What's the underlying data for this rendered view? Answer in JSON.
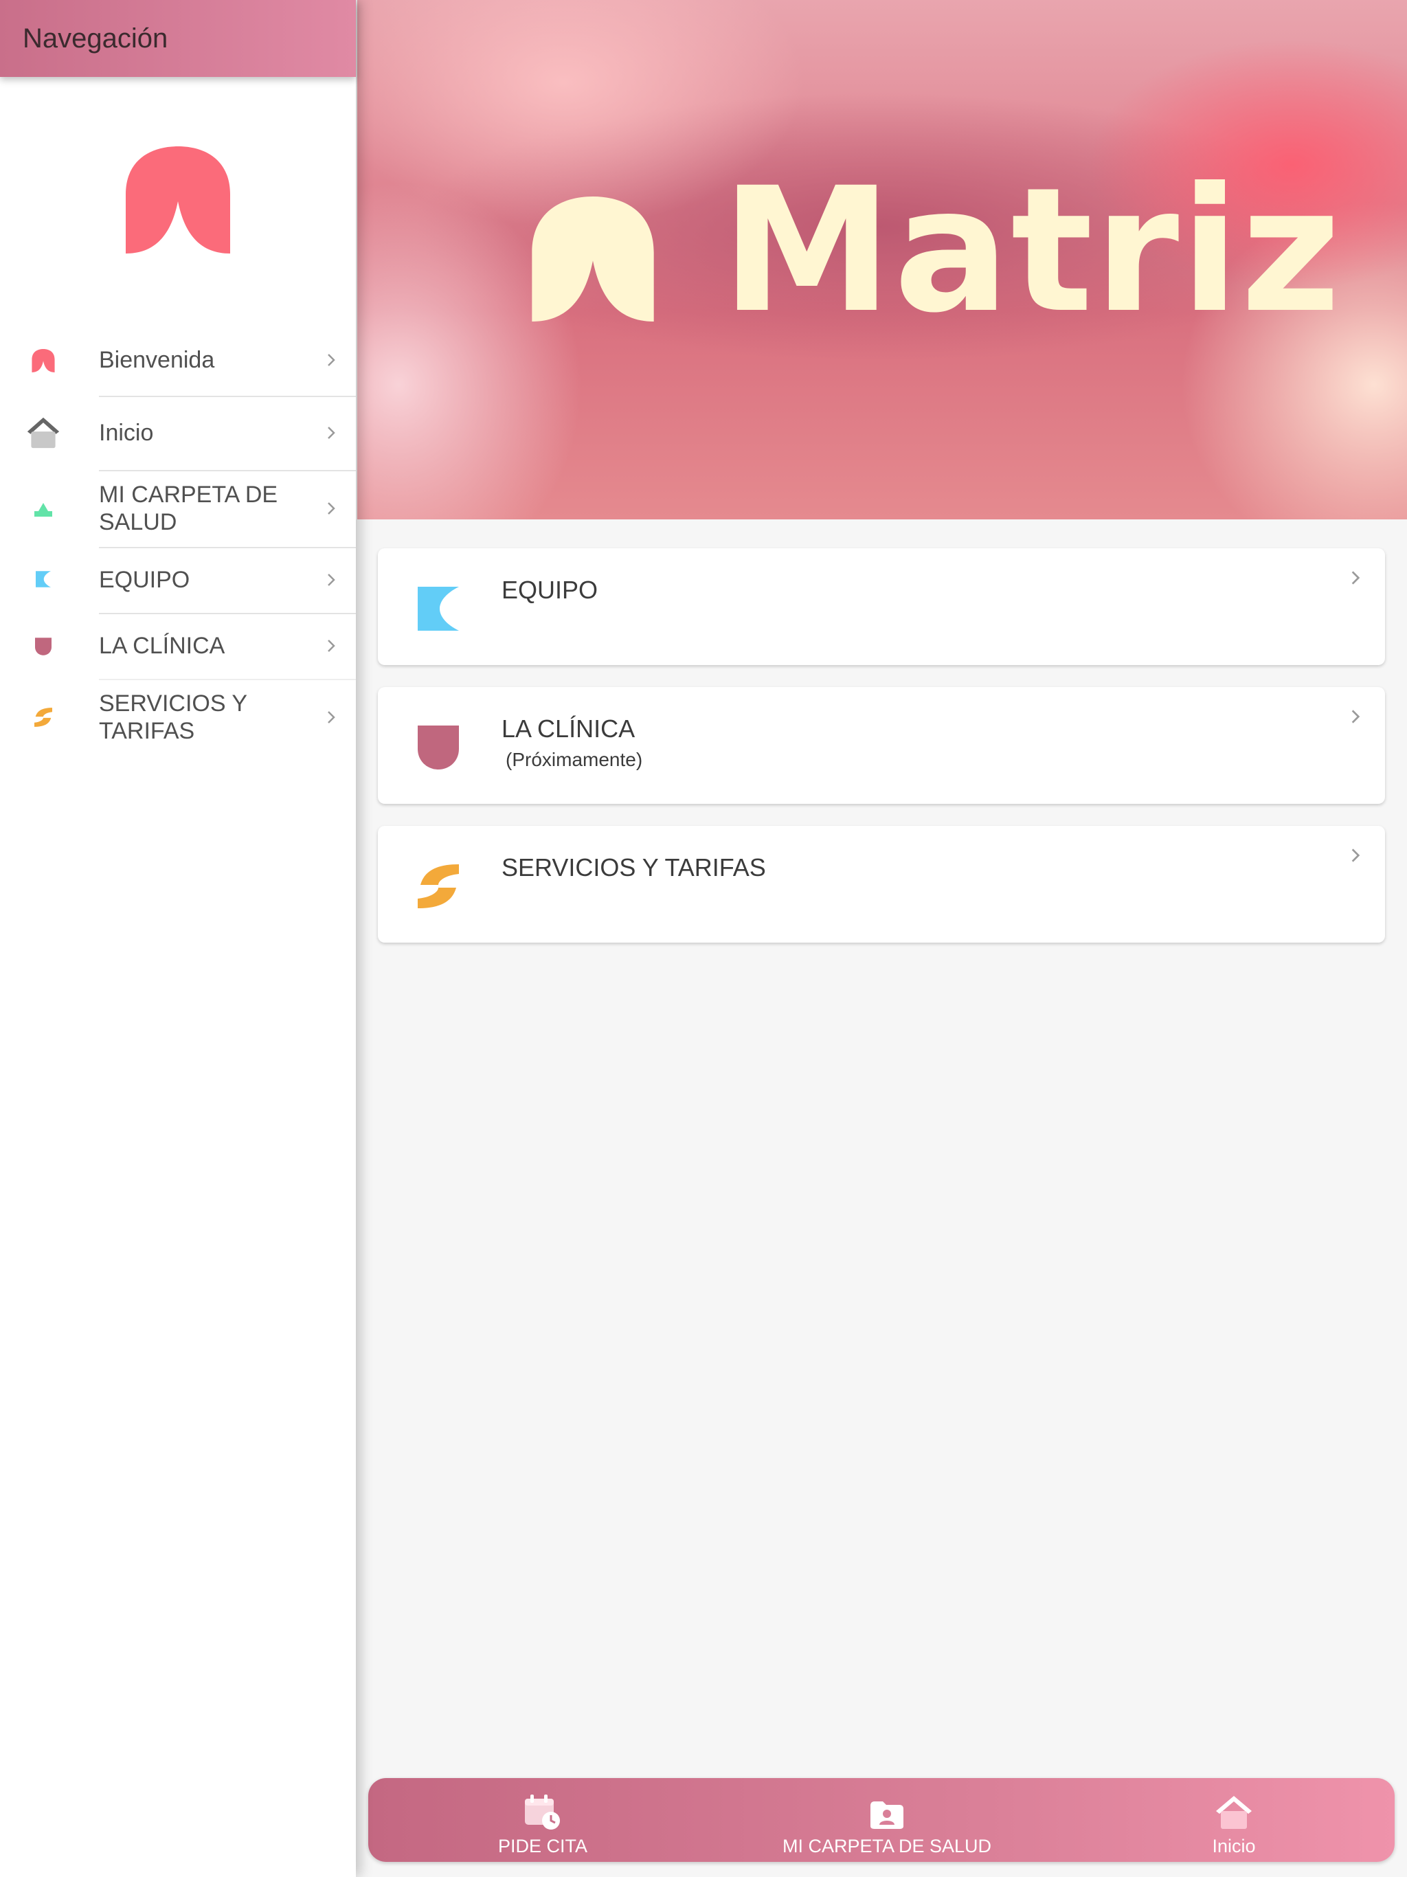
{
  "sidebar": {
    "title": "Navegación",
    "items": [
      {
        "label": "Bienvenida",
        "icon": "matriz-arch-icon"
      },
      {
        "label": "Inicio",
        "icon": "home-icon"
      },
      {
        "label": "MI CARPETA DE SALUD",
        "icon": "green-arch-icon"
      },
      {
        "label": "EQUIPO",
        "icon": "crescent-icon"
      },
      {
        "label": "LA CLÍNICA",
        "icon": "shield-icon"
      },
      {
        "label": "SERVICIOS Y TARIFAS",
        "icon": "s-wave-icon"
      }
    ]
  },
  "hero": {
    "brand": "Matriz"
  },
  "cards": [
    {
      "title": "EQUIPO",
      "subtitle": "",
      "icon": "crescent-icon"
    },
    {
      "title": "LA CLÍNICA",
      "subtitle": "(Próximamente)",
      "icon": "shield-icon"
    },
    {
      "title": "SERVICIOS Y TARIFAS",
      "subtitle": "",
      "icon": "s-wave-icon"
    }
  ],
  "tabbar": {
    "tabs": [
      {
        "label": "PIDE CITA",
        "icon": "calendar-clock-icon"
      },
      {
        "label": "MI CARPETA DE SALUD",
        "icon": "folder-user-icon"
      },
      {
        "label": "Inicio",
        "icon": "home-icon"
      }
    ]
  },
  "colors": {
    "header_gradient": [
      "#c96f8a",
      "#e08aa4"
    ],
    "logo_coral": "#fb6b7a",
    "brand_cream": "#fff6d2",
    "equipo_blue": "#62cdf7",
    "clinica_rose": "#c0677e",
    "servicios_orange": "#f3a93a",
    "carpeta_green": "#62e3a8"
  }
}
